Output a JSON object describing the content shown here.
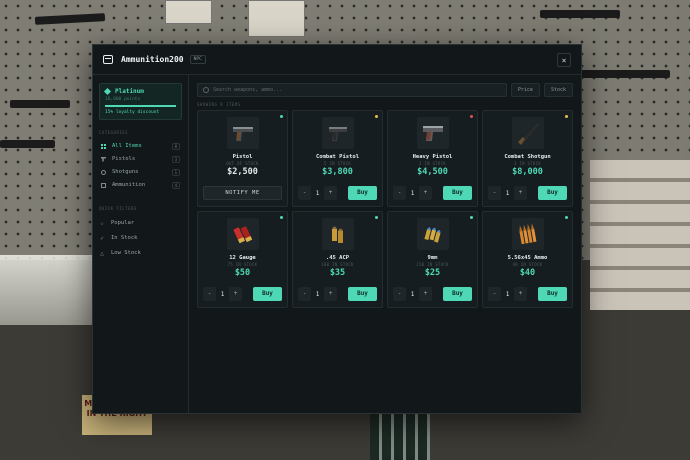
{
  "window": {
    "title": "Ammunition200",
    "badge": "NPC"
  },
  "loyalty": {
    "tier": "Platinum",
    "points_text": "10,000 points",
    "progress": 1.0,
    "discount_text": "15% loyalty discount"
  },
  "sidebar": {
    "categories_label": "CATEGORIES",
    "categories": [
      {
        "label": "All Items",
        "count": "8",
        "icon": "grid-icon",
        "active": true
      },
      {
        "label": "Pistols",
        "count": "3",
        "icon": "pistol-icon",
        "active": false
      },
      {
        "label": "Shotguns",
        "count": "1",
        "icon": "shotgun-icon",
        "active": false
      },
      {
        "label": "Ammunition",
        "count": "4",
        "icon": "ammo-icon",
        "active": false
      }
    ],
    "filters_label": "QUICK FILTERS",
    "filters": [
      {
        "label": "Popular",
        "icon": "star-icon"
      },
      {
        "label": "In Stock",
        "icon": "check-icon"
      },
      {
        "label": "Low Stock",
        "icon": "warning-icon"
      }
    ]
  },
  "toolbar": {
    "search_placeholder": "Search weapons, ammo...",
    "sort_price": "Price",
    "sort_stock": "Stock"
  },
  "grid_heading": "SHOWING 8 ITEMS",
  "items": [
    {
      "name": "Pistol",
      "stock": "OUT OF STOCK",
      "price": "$2,500",
      "status_color": "#4fd8b6",
      "icon": "pistol-icon",
      "action": "NOTIFY ME"
    },
    {
      "name": "Combat Pistol",
      "stock": "5 IN STOCK",
      "price": "$3,800",
      "status_color": "#e0c24a",
      "icon": "combat-pistol-icon",
      "qty": "1",
      "buy": "Buy",
      "minus": "-",
      "plus": "+"
    },
    {
      "name": "Heavy Pistol",
      "stock": "2 IN STOCK",
      "price": "$4,500",
      "status_color": "#d9534f",
      "icon": "heavy-pistol-icon",
      "qty": "1",
      "buy": "Buy",
      "minus": "-",
      "plus": "+"
    },
    {
      "name": "Combat Shotgun",
      "stock": "3 IN STOCK",
      "price": "$8,000",
      "status_color": "#e0c24a",
      "icon": "shotgun-icon",
      "qty": "1",
      "buy": "Buy",
      "minus": "-",
      "plus": "+"
    },
    {
      "name": "12 Gauge",
      "stock": "75 IN STOCK",
      "price": "$50",
      "status_color": "#4fd8b6",
      "icon": "shotgun-shells-icon",
      "qty": "1",
      "buy": "Buy",
      "minus": "-",
      "plus": "+"
    },
    {
      "name": ".45 ACP",
      "stock": "100 IN STOCK",
      "price": "$35",
      "status_color": "#4fd8b6",
      "icon": "acp-rounds-icon",
      "qty": "1",
      "buy": "Buy",
      "minus": "-",
      "plus": "+"
    },
    {
      "name": "9mm",
      "stock": "150 IN STOCK",
      "price": "$25",
      "status_color": "#4fd8b6",
      "icon": "9mm-rounds-icon",
      "qty": "1",
      "buy": "Buy",
      "minus": "-",
      "plus": "+"
    },
    {
      "name": "5.56x45 Ammo",
      "stock": "90 IN STOCK",
      "price": "$40",
      "status_color": "#4fd8b6",
      "icon": "rifle-rounds-icon",
      "qty": "1",
      "buy": "Buy",
      "minus": "-",
      "plus": "+"
    }
  ],
  "background": {
    "poster_text": "MOST BELIEVE IN THE RIGHT"
  }
}
